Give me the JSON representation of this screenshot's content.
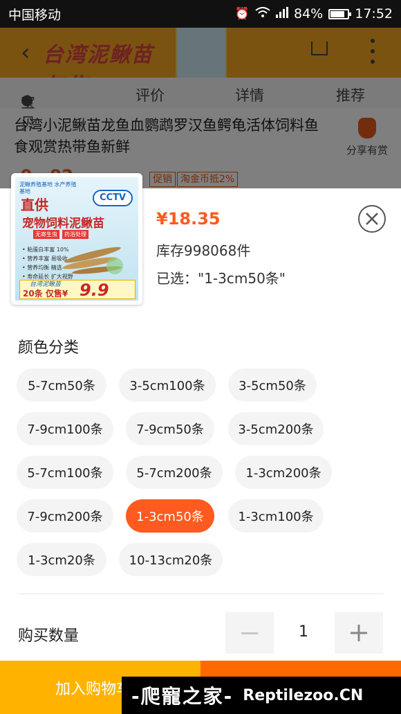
{
  "status_bar": {
    "carrier": "中国移动",
    "battery": "84%",
    "time": "17:52"
  },
  "background_page": {
    "banner_text": "台湾泥鳅苗",
    "banner_price": "仅售¥",
    "tabs": [
      "宝贝",
      "评价",
      "详情",
      "推荐"
    ],
    "title": "台湾小泥鳅苗龙鱼血鹦鹉罗汉鱼鳄龟活体饲料鱼食观赏热带鱼新鲜",
    "share_label": "分享有赏",
    "price_partial": "9 . 92",
    "tag_promo": "促销",
    "tag_cashback": "淘金币抵2%"
  },
  "product_image": {
    "top_text": "泥鳅养殖基地 水产养殖基地",
    "headline": "直供",
    "brand": "CCTV",
    "product_name": "宠物饲料泥鳅苗",
    "chips": [
      "无寄生虫",
      "药浴处理"
    ],
    "features": [
      "• 粘蛋白丰富 10%",
      "• 营养丰富 易吸收",
      "• 营养均衡 精选",
      "• 寿命延长 扩大视野"
    ],
    "banner_name": "台湾泥鳅苗",
    "banner_count": "20条 仅售¥",
    "banner_price": "9.9"
  },
  "sku_panel": {
    "price": "¥18.35",
    "stock": "库存998068件",
    "selected": "已选：\"1-3cm50条\"",
    "section_title": "颜色分类",
    "options": [
      {
        "label": "5-7cm50条",
        "selected": false
      },
      {
        "label": "3-5cm100条",
        "selected": false
      },
      {
        "label": "3-5cm50条",
        "selected": false
      },
      {
        "label": "7-9cm100条",
        "selected": false
      },
      {
        "label": "7-9cm50条",
        "selected": false
      },
      {
        "label": "3-5cm200条",
        "selected": false
      },
      {
        "label": "5-7cm100条",
        "selected": false
      },
      {
        "label": "5-7cm200条",
        "selected": false
      },
      {
        "label": "1-3cm200条",
        "selected": false
      },
      {
        "label": "7-9cm200条",
        "selected": false
      },
      {
        "label": "1-3cm50条",
        "selected": true
      },
      {
        "label": "1-3cm100条",
        "selected": false
      },
      {
        "label": "1-3cm20条",
        "selected": false
      },
      {
        "label": "10-13cm20条",
        "selected": false
      }
    ],
    "quantity_label": "购买数量",
    "quantity": "1"
  },
  "bottom_bar": {
    "add_to_cart": "加入购物车"
  },
  "watermark": {
    "cn": "-爬寵之家-",
    "en": "Reptilezoo.CN"
  },
  "colors": {
    "accent": "#ff5a1f",
    "cart_button": "#ffb300",
    "buy_button": "#ff6a00"
  },
  "icons": [
    "back-icon",
    "cart-icon",
    "more-icon",
    "location-pin-icon",
    "money-bag-icon",
    "close-icon",
    "minus-icon",
    "plus-icon",
    "wifi-icon",
    "signal-icon",
    "alarm-icon",
    "battery-icon"
  ]
}
